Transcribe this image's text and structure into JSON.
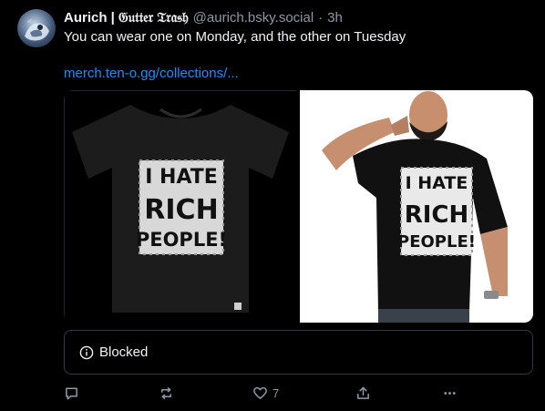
{
  "post": {
    "author": {
      "display_name": "Aurich | 𝔊𝔲𝔱𝔱𝔢𝔯 𝔗𝔯𝔞𝔰𝔥",
      "handle": "@aurich.bsky.social",
      "time": "3h"
    },
    "text": "You can wear one on Monday, and the other on Tuesday",
    "link_text": "merch.ten-o.gg/collections/...",
    "images": [
      {
        "shirt_lines": [
          "I HATE",
          "RICH",
          "PEOPLE!"
        ]
      },
      {
        "shirt_lines": [
          "I HATE",
          "RICH",
          "PEOPLE!"
        ]
      }
    ],
    "quote_status": "Blocked",
    "actions": {
      "reply_icon": "reply-icon",
      "repost_icon": "repost-icon",
      "like_icon": "heart-icon",
      "like_count": "7",
      "share_icon": "share-icon",
      "more_icon": "more-icon"
    }
  },
  "colors": {
    "background": "#000000",
    "text_primary": "#f1f3f5",
    "text_secondary": "#8c99a8",
    "link": "#208bfe",
    "border": "#2e3a48"
  }
}
